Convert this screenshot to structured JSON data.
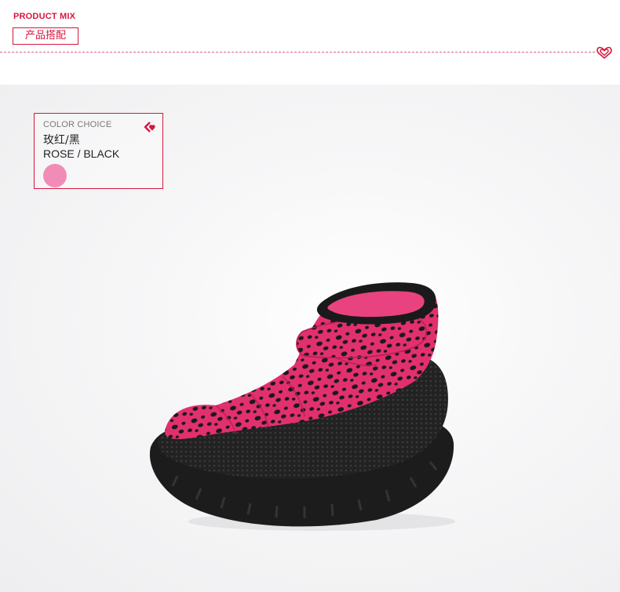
{
  "header": {
    "title": "PRODUCT MIX",
    "subtitle": "产品搭配",
    "accent_color": "#d7163e",
    "heart_icon": "double-heart-icon"
  },
  "color_choice": {
    "label": "COLOR CHOICE",
    "name_cn": "玫红/黑",
    "name_en": "ROSE / BLACK",
    "swatch_color": "#f18cb6",
    "back_icon": "chevron-left-heart-icon"
  },
  "product": {
    "description": "rose leopard-print padded kids snow boot with black mesh and sole",
    "colors": {
      "upper": "#e2306f",
      "spots": "#1a1a1a",
      "sole": "#1c1c1c",
      "lining": "#e8427f"
    }
  }
}
